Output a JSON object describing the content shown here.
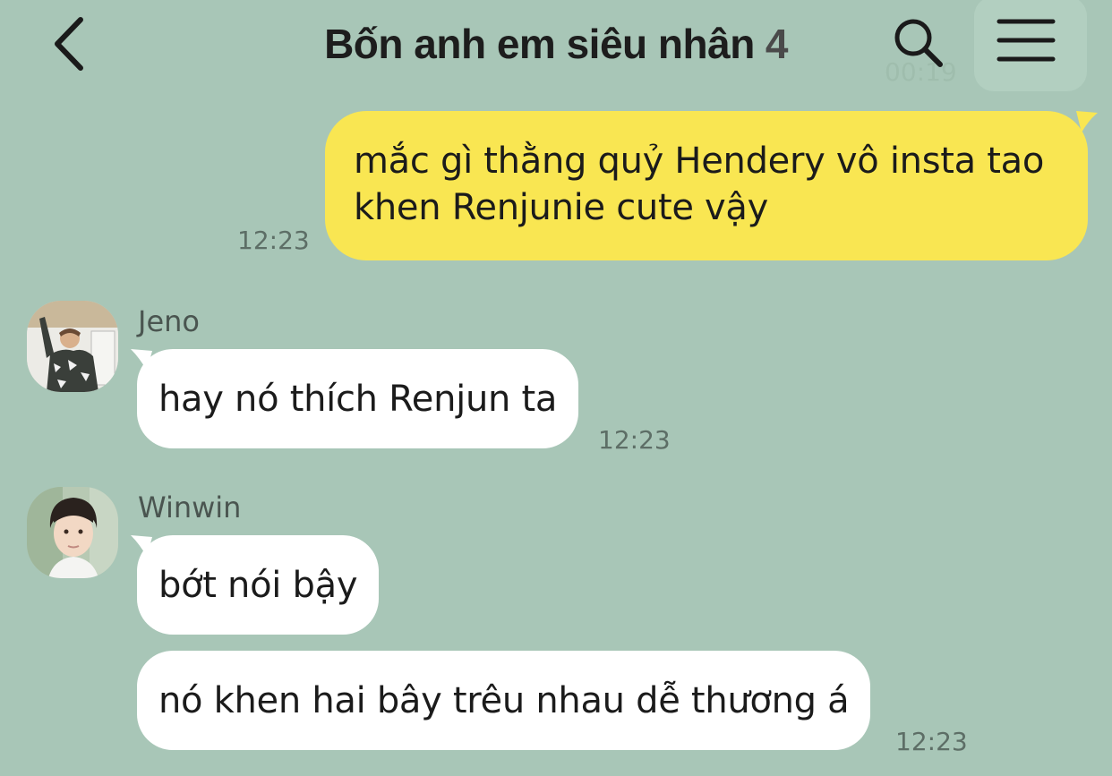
{
  "header": {
    "title": "Bốn anh em siêu nhân",
    "member_count": "4",
    "faded_time": "00:19"
  },
  "messages": [
    {
      "sender": "me",
      "line1": "mắc gì thằng quỷ Hendery vô insta tao",
      "line2": "khen Renjunie cute vậy",
      "time": "12:23"
    },
    {
      "sender": "Jeno",
      "text": "hay nó thích Renjun ta",
      "time": "12:23"
    },
    {
      "sender": "Winwin",
      "text1": "bớt nói bậy",
      "text2": "nó khen hai bây trêu nhau dễ thương á",
      "time": "12:23"
    }
  ],
  "icons": {
    "back": "chevron-left-icon",
    "search": "search-icon",
    "menu": "hamburger-menu-icon"
  },
  "colors": {
    "background": "#a8c6b7",
    "my_bubble": "#f9e652",
    "their_bubble": "#ffffff"
  }
}
